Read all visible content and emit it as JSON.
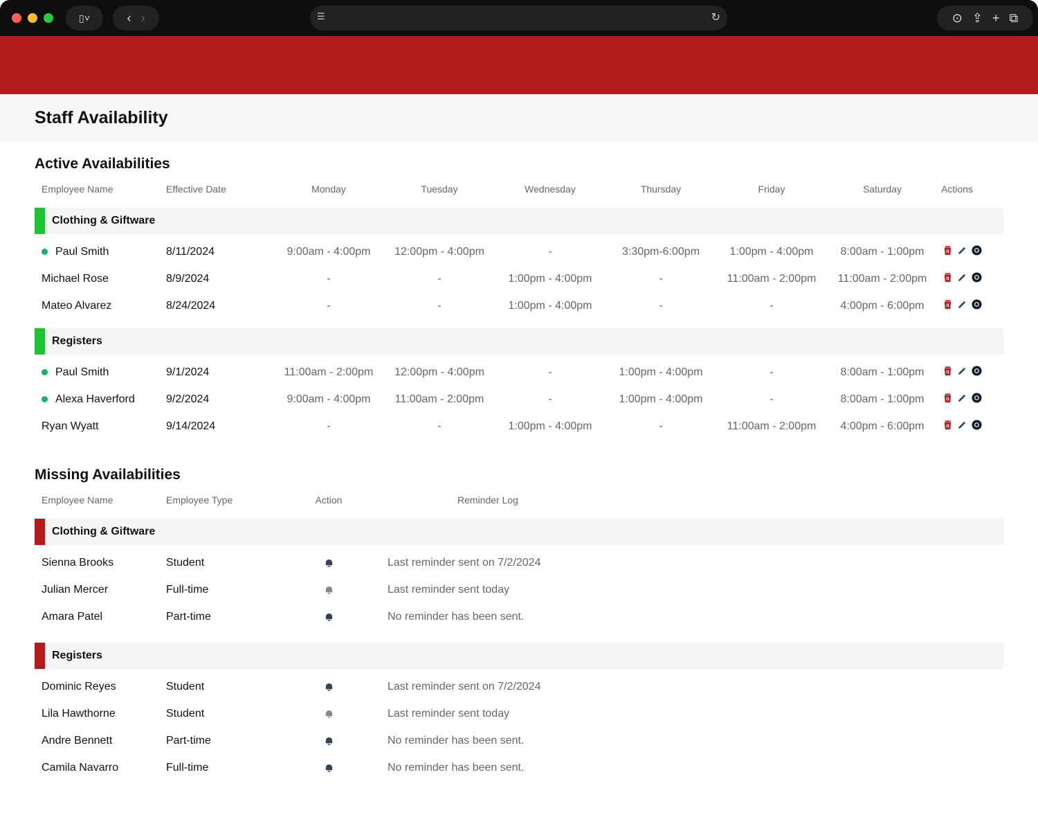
{
  "page": {
    "title": "Staff Availability"
  },
  "active": {
    "heading": "Active Availabilities",
    "columns": [
      "Employee Name",
      "Effective Date",
      "Monday",
      "Tuesday",
      "Wednesday",
      "Thursday",
      "Friday",
      "Saturday",
      "Actions"
    ],
    "groups": [
      {
        "name": "Clothing & Giftware",
        "color": "#1fc232",
        "rows": [
          {
            "name": "Paul Smith",
            "dot": true,
            "date": "8/11/2024",
            "days": [
              "9:00am - 4:00pm",
              "12:00pm - 4:00pm",
              "-",
              "3:30pm-6:00pm",
              "1:00pm - 4:00pm",
              "8:00am - 1:00pm"
            ]
          },
          {
            "name": "Michael Rose",
            "dot": false,
            "date": "8/9/2024",
            "days": [
              "-",
              "-",
              "1:00pm - 4:00pm",
              "-",
              "11:00am - 2:00pm",
              "11:00am - 2:00pm"
            ]
          },
          {
            "name": "Mateo Alvarez",
            "dot": false,
            "date": "8/24/2024",
            "days": [
              "-",
              "-",
              "1:00pm - 4:00pm",
              "-",
              "-",
              "4:00pm - 6:00pm"
            ]
          }
        ]
      },
      {
        "name": "Registers",
        "color": "#1fc232",
        "rows": [
          {
            "name": "Paul Smith",
            "dot": true,
            "date": "9/1/2024",
            "days": [
              "11:00am - 2:00pm",
              "12:00pm - 4:00pm",
              "-",
              "1:00pm - 4:00pm",
              "-",
              "8:00am - 1:00pm"
            ]
          },
          {
            "name": "Alexa Haverford",
            "dot": true,
            "date": "9/2/2024",
            "days": [
              "9:00am - 4:00pm",
              "11:00am - 2:00pm",
              "-",
              "1:00pm - 4:00pm",
              "-",
              "8:00am - 1:00pm"
            ]
          },
          {
            "name": "Ryan Wyatt",
            "dot": false,
            "date": "9/14/2024",
            "days": [
              "-",
              "-",
              "1:00pm - 4:00pm",
              "-",
              "11:00am - 2:00pm",
              "4:00pm - 6:00pm"
            ]
          }
        ]
      }
    ]
  },
  "missing": {
    "heading": "Missing Availabilities",
    "columns": [
      "Employee Name",
      "Employee Type",
      "Action",
      "Reminder Log"
    ],
    "groups": [
      {
        "name": "Clothing & Giftware",
        "color": "#b31b1b",
        "rows": [
          {
            "name": "Sienna Brooks",
            "type": "Student",
            "bell": "active",
            "log": "Last reminder sent on 7/2/2024"
          },
          {
            "name": "Julian Mercer",
            "type": "Full-time",
            "bell": "disabled",
            "log": "Last reminder sent today"
          },
          {
            "name": "Amara Patel",
            "type": "Part-time",
            "bell": "active",
            "log": "No reminder has been sent."
          }
        ]
      },
      {
        "name": "Registers",
        "color": "#b31b1b",
        "rows": [
          {
            "name": "Dominic Reyes",
            "type": "Student",
            "bell": "active",
            "log": "Last reminder sent on 7/2/2024"
          },
          {
            "name": "Lila Hawthorne",
            "type": "Student",
            "bell": "disabled",
            "log": "Last reminder sent today"
          },
          {
            "name": "Andre Bennett",
            "type": "Part-time",
            "bell": "active",
            "log": "No reminder has been sent."
          },
          {
            "name": "Camila Navarro",
            "type": "Full-time",
            "bell": "active",
            "log": "No reminder has been sent."
          }
        ]
      }
    ]
  },
  "colors": {
    "banner": "#b31b1b",
    "bell_active": "#2f4459",
    "bell_disabled": "#888888"
  }
}
